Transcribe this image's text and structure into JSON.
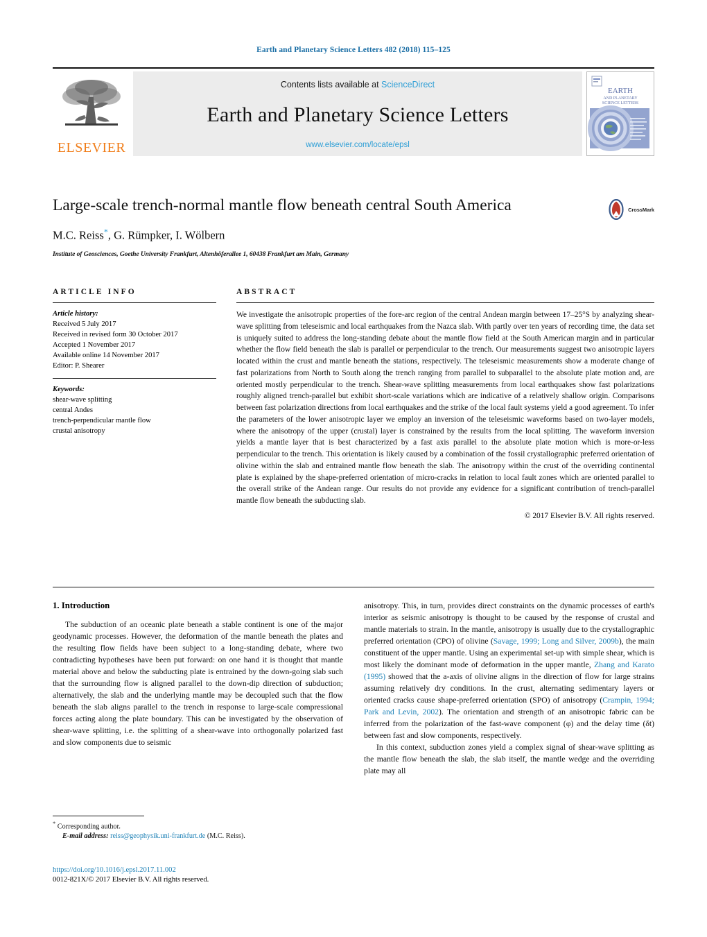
{
  "running_head": "Earth and Planetary Science Letters 482 (2018) 115–125",
  "masthead": {
    "contents_prefix": "Contents lists available at ",
    "sciencedirect": "ScienceDirect",
    "journal_name": "Earth and Planetary Science Letters",
    "journal_url": "www.elsevier.com/locate/epsl",
    "publisher": "ELSEVIER",
    "cover_title_line1": "EARTH",
    "cover_title_line2": "AND PLANETARY",
    "cover_title_line3": "SCIENCE LETTERS"
  },
  "article": {
    "title": "Large-scale trench-normal mantle flow beneath central South America",
    "authors": "M.C. Reiss",
    "authors_rest": ", G. Rümpker, I. Wölbern",
    "affiliation": "Institute of Geosciences, Goethe University Frankfurt, Altenhöferallee 1, 60438 Frankfurt am Main, Germany",
    "crossmark_label": "CrossMark"
  },
  "info": {
    "heading": "ARTICLE INFO",
    "history_label": "Article history:",
    "history": [
      "Received 5 July 2017",
      "Received in revised form 30 October 2017",
      "Accepted 1 November 2017",
      "Available online 14 November 2017",
      "Editor: P. Shearer"
    ],
    "keywords_label": "Keywords:",
    "keywords": [
      "shear-wave splitting",
      "central Andes",
      "trench-perpendicular mantle flow",
      "crustal anisotropy"
    ]
  },
  "abstract": {
    "heading": "ABSTRACT",
    "text": "We investigate the anisotropic properties of the fore-arc region of the central Andean margin between 17–25°S by analyzing shear-wave splitting from teleseismic and local earthquakes from the Nazca slab. With partly over ten years of recording time, the data set is uniquely suited to address the long-standing debate about the mantle flow field at the South American margin and in particular whether the flow field beneath the slab is parallel or perpendicular to the trench. Our measurements suggest two anisotropic layers located within the crust and mantle beneath the stations, respectively. The teleseismic measurements show a moderate change of fast polarizations from North to South along the trench ranging from parallel to subparallel to the absolute plate motion and, are oriented mostly perpendicular to the trench. Shear-wave splitting measurements from local earthquakes show fast polarizations roughly aligned trench-parallel but exhibit short-scale variations which are indicative of a relatively shallow origin. Comparisons between fast polarization directions from local earthquakes and the strike of the local fault systems yield a good agreement. To infer the parameters of the lower anisotropic layer we employ an inversion of the teleseismic waveforms based on two-layer models, where the anisotropy of the upper (crustal) layer is constrained by the results from the local splitting. The waveform inversion yields a mantle layer that is best characterized by a fast axis parallel to the absolute plate motion which is more-or-less perpendicular to the trench. This orientation is likely caused by a combination of the fossil crystallographic preferred orientation of olivine within the slab and entrained mantle flow beneath the slab. The anisotropy within the crust of the overriding continental plate is explained by the shape-preferred orientation of micro-cracks in relation to local fault zones which are oriented parallel to the overall strike of the Andean range. Our results do not provide any evidence for a significant contribution of trench-parallel mantle flow beneath the subducting slab.",
    "copyright": "© 2017 Elsevier B.V. All rights reserved."
  },
  "introduction": {
    "heading": "1. Introduction",
    "left_para": "The subduction of an oceanic plate beneath a stable continent is one of the major geodynamic processes. However, the deformation of the mantle beneath the plates and the resulting flow fields have been subject to a long-standing debate, where two contradicting hypotheses have been put forward: on one hand it is thought that mantle material above and below the subducting plate is entrained by the down-going slab such that the surrounding flow is aligned parallel to the down-dip direction of subduction; alternatively, the slab and the underlying mantle may be decoupled such that the flow beneath the slab aligns parallel to the trench in response to large-scale compressional forces acting along the plate boundary. This can be investigated by the observation of shear-wave splitting, i.e. the splitting of a shear-wave into orthogonally polarized fast and slow components due to seismic",
    "right_para_1a": "anisotropy. This, in turn, provides direct constraints on the dynamic processes of earth's interior as seismic anisotropy is thought to be caused by the response of crustal and mantle materials to strain. In the mantle, anisotropy is usually due to the crystallographic preferred orientation (CPO) of olivine (",
    "right_cite_1": "Savage, 1999; Long and Silver, 2009b",
    "right_para_1b": "), the main constituent of the upper mantle. Using an experimental set-up with simple shear, which is most likely the dominant mode of deformation in the upper mantle, ",
    "right_cite_2": "Zhang and Karato (1995)",
    "right_para_1c": " showed that the a-axis of olivine aligns in the direction of flow for large strains assuming relatively dry conditions. In the crust, alternating sedimentary layers or oriented cracks cause shape-preferred orientation (SPO) of anisotropy (",
    "right_cite_3": "Crampin, 1994; Park and Levin, 2002",
    "right_para_1d": "). The orientation and strength of an anisotropic fabric can be inferred from the polarization of the fast-wave component (φ) and the delay time (δt) between fast and slow components, respectively.",
    "right_para_2": "In this context, subduction zones yield a complex signal of shear-wave splitting as the mantle flow beneath the slab, the slab itself, the mantle wedge and the overriding plate may all"
  },
  "footnotes": {
    "corresponding_star": "*",
    "corresponding_text": "Corresponding author.",
    "email_label": "E-mail address:",
    "email": "reiss@geophysik.uni-frankfurt.de",
    "email_suffix": "(M.C. Reiss).",
    "doi": "https://doi.org/10.1016/j.epsl.2017.11.002",
    "issn_line": "0012-821X/© 2017 Elsevier B.V. All rights reserved."
  },
  "colors": {
    "link_blue": "#1a7fb5",
    "sd_blue": "#2f9fd6",
    "elsevier_orange": "#f07d19",
    "cover_blue": "#7b8fc4"
  }
}
